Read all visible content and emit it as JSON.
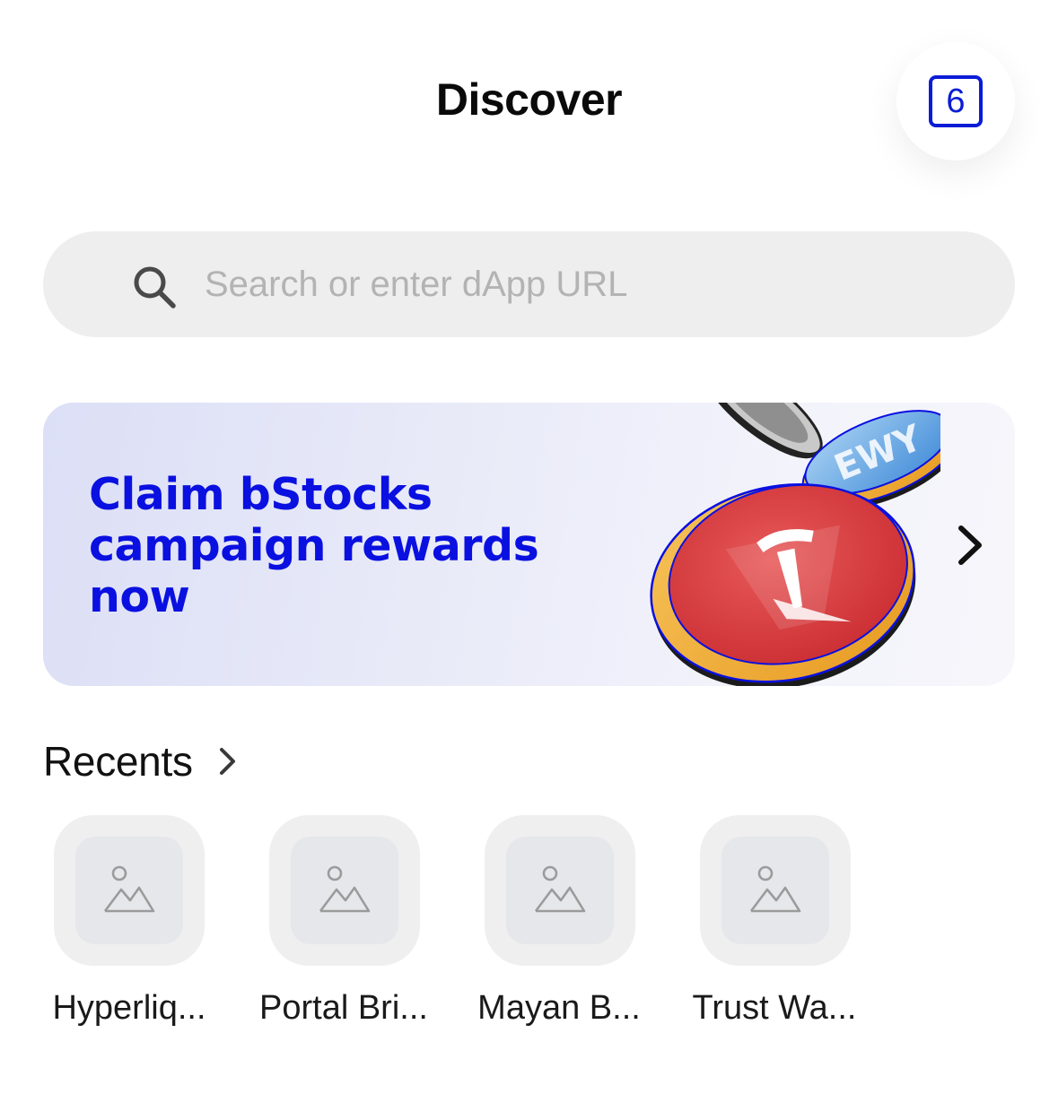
{
  "header": {
    "title": "Discover",
    "tabs_count": "6"
  },
  "search": {
    "placeholder": "Search or enter dApp URL",
    "value": ""
  },
  "banner": {
    "line1": "Claim bStocks",
    "line2": "campaign rewards",
    "line3": "now",
    "coin_label": "EWY"
  },
  "recents": {
    "title": "Recents",
    "items": [
      {
        "label": "Hyperliq..."
      },
      {
        "label": "Portal Bri..."
      },
      {
        "label": "Mayan B..."
      },
      {
        "label": "Trust Wa..."
      }
    ]
  },
  "colors": {
    "accent": "#0a1cd6",
    "banner_text": "#0a10e0",
    "search_bg": "#eeeeee",
    "tile_bg": "#efefef"
  },
  "icons": {
    "search": "search-icon",
    "banner_next": "chevron-right-icon",
    "recents_more": "chevron-right-icon",
    "placeholder_image": "image-placeholder-icon"
  }
}
